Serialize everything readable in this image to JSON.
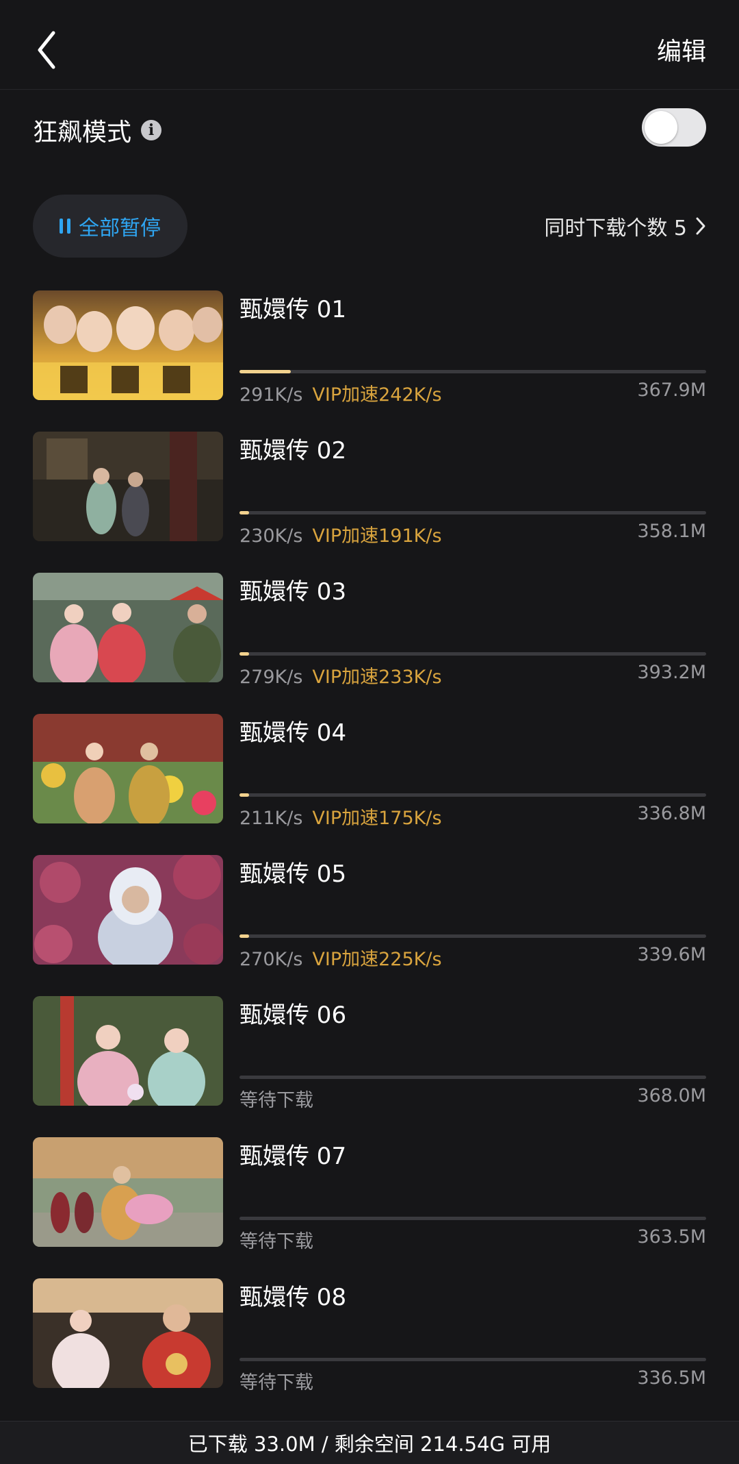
{
  "header": {
    "back_icon": "chevron-left-icon",
    "edit_label": "编辑"
  },
  "turbo": {
    "label": "狂飙模式",
    "info_icon": "i",
    "enabled": false
  },
  "toolbar": {
    "pause_all_label": "全部暂停",
    "concurrent_label": "同时下载个数 5"
  },
  "downloads": [
    {
      "title": "甄嬛传 01",
      "speed": "291K/s",
      "vip": "VIP加速242K/s",
      "size": "367.9M",
      "progress": 0.11
    },
    {
      "title": "甄嬛传 02",
      "speed": "230K/s",
      "vip": "VIP加速191K/s",
      "size": "358.1M",
      "progress": 0.02
    },
    {
      "title": "甄嬛传 03",
      "speed": "279K/s",
      "vip": "VIP加速233K/s",
      "size": "393.2M",
      "progress": 0.02
    },
    {
      "title": "甄嬛传 04",
      "speed": "211K/s",
      "vip": "VIP加速175K/s",
      "size": "336.8M",
      "progress": 0.02
    },
    {
      "title": "甄嬛传 05",
      "speed": "270K/s",
      "vip": "VIP加速225K/s",
      "size": "339.6M",
      "progress": 0.02
    },
    {
      "title": "甄嬛传 06",
      "speed": "等待下载",
      "vip": "",
      "size": "368.0M",
      "progress": 0
    },
    {
      "title": "甄嬛传 07",
      "speed": "等待下载",
      "vip": "",
      "size": "363.5M",
      "progress": 0
    },
    {
      "title": "甄嬛传 08",
      "speed": "等待下载",
      "vip": "",
      "size": "336.5M",
      "progress": 0
    }
  ],
  "footer": {
    "storage_text": "已下载 33.0M / 剩余空间 214.54G 可用"
  },
  "colors": {
    "accent_blue": "#2fa6f2",
    "vip_gold": "#d9a43e",
    "progress_fill": "#f2d28e"
  }
}
